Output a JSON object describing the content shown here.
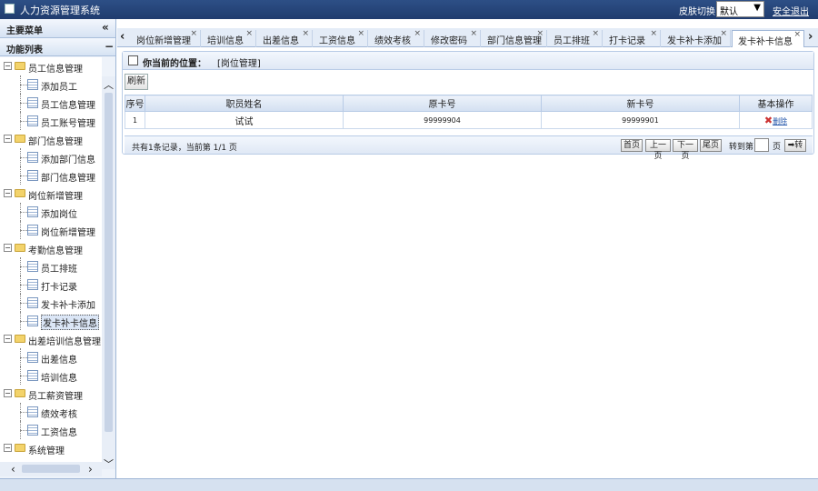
{
  "header": {
    "title": "人力资源管理系统",
    "skin_label": "皮肤切换：",
    "skin_value": "默认",
    "logout": "安全退出"
  },
  "sidebar": {
    "main_menu": "主要菜单",
    "collapse": "«",
    "func_list": "功能列表",
    "minus": "−",
    "groups": [
      {
        "label": "员工信息管理",
        "items": [
          "添加员工",
          "员工信息管理",
          "员工账号管理"
        ]
      },
      {
        "label": "部门信息管理",
        "items": [
          "添加部门信息",
          "部门信息管理"
        ]
      },
      {
        "label": "岗位新增管理",
        "items": [
          "添加岗位",
          "岗位新增管理"
        ]
      },
      {
        "label": "考勤信息管理",
        "items": [
          "员工排班",
          "打卡记录",
          "发卡补卡添加",
          "发卡补卡信息"
        ]
      },
      {
        "label": "出差培训信息管理",
        "items": [
          "出差信息",
          "培训信息"
        ]
      },
      {
        "label": "员工薪资管理",
        "items": [
          "绩效考核",
          "工资信息"
        ]
      },
      {
        "label": "系统管理",
        "items": []
      }
    ]
  },
  "tabs": [
    "岗位新增管理",
    "培训信息",
    "出差信息",
    "工资信息",
    "绩效考核",
    "修改密码",
    "部门信息管理",
    "员工排班",
    "打卡记录",
    "发卡补卡添加",
    "发卡补卡信息"
  ],
  "tab_close": "×",
  "location": {
    "label": "你当前的位置：",
    "value": "[岗位管理]"
  },
  "toolbar": {
    "refresh": "刷新"
  },
  "table": {
    "columns": [
      "序号",
      "职员姓名",
      "原卡号",
      "新卡号",
      "基本操作"
    ],
    "rows": [
      {
        "index": "1",
        "name": "试试",
        "old_card": "99999904",
        "new_card": "99999901",
        "action": "删除"
      }
    ]
  },
  "pager": {
    "info": "共有1条记录，当前第 1/1 页",
    "first": "首页",
    "prev": "上一页",
    "next": "下一页",
    "last": "尾页",
    "goto": "转到第",
    "page_unit": "页",
    "go": "➡转"
  }
}
